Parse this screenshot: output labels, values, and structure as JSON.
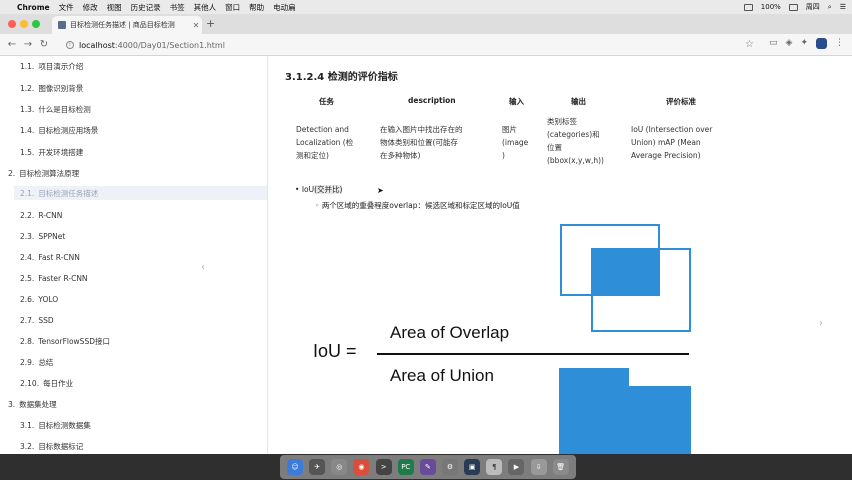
{
  "menubar": {
    "app": "Chrome",
    "items": [
      "文件",
      "修改",
      "视图",
      "历史记录",
      "书签",
      "其他人",
      "窗口",
      "帮助",
      "电动扁"
    ],
    "right": {
      "battery": "100%",
      "clock": "周四"
    }
  },
  "browser": {
    "tab_title": "目标检测任务描述 | 商品目标检测",
    "url_host": "localhost",
    "url_path": ":4000/Day01/Section1.html"
  },
  "sidebar": {
    "items": [
      {
        "num": "1.1.",
        "label": "项目演示介绍"
      },
      {
        "num": "1.2.",
        "label": "图像识别背景"
      },
      {
        "num": "1.3.",
        "label": "什么是目标检测"
      },
      {
        "num": "1.4.",
        "label": "目标检测应用场景"
      },
      {
        "num": "1.5.",
        "label": "开发环境搭建"
      },
      {
        "num": "2.",
        "label": "目标检测算法原理"
      },
      {
        "num": "2.1.",
        "label": "目标检测任务描述"
      },
      {
        "num": "2.2.",
        "label": "R-CNN"
      },
      {
        "num": "2.3.",
        "label": "SPPNet"
      },
      {
        "num": "2.4.",
        "label": "Fast R-CNN"
      },
      {
        "num": "2.5.",
        "label": "Faster R-CNN"
      },
      {
        "num": "2.6.",
        "label": "YOLO"
      },
      {
        "num": "2.7.",
        "label": "SSD"
      },
      {
        "num": "2.8.",
        "label": "TensorFlowSSD接口"
      },
      {
        "num": "2.9.",
        "label": "总结"
      },
      {
        "num": "2.10.",
        "label": "每日作业"
      },
      {
        "num": "3.",
        "label": "数据集处理"
      },
      {
        "num": "3.1.",
        "label": "目标检测数据集"
      },
      {
        "num": "3.2.",
        "label": "目标数据标记"
      }
    ]
  },
  "content": {
    "section_title": "3.1.2.4 检测的评价指标",
    "table": {
      "headers": [
        "任务",
        "description",
        "输入",
        "输出",
        "评价标准"
      ],
      "row": {
        "task": [
          "Detection and",
          "Localization (检",
          "测和定位)"
        ],
        "description": [
          "在输入图片中找出存在的",
          "物体类别和位置(可能存",
          "在多种物体)"
        ],
        "input": [
          "图片",
          "(image",
          ")"
        ],
        "output": [
          "类别标签",
          "(categories)和",
          "位置",
          "(bbox(x,y,w,h))"
        ],
        "metric": [
          "IoU (Intersection over",
          "Union) mAP (Mean",
          "Average Precision)"
        ]
      }
    },
    "bullet_1_prefix": "IoU",
    "bullet_1_highlight": "(交并比)",
    "bullet_2": "两个区域的重叠程度overlap：候选区域和标定区域的IoU值"
  },
  "diagram": {
    "lhs": "IoU =",
    "numerator": "Area of Overlap",
    "denominator": "Area of Union",
    "fill_color": "#2e8fd8",
    "stroke_color": "#2e8fd8"
  }
}
